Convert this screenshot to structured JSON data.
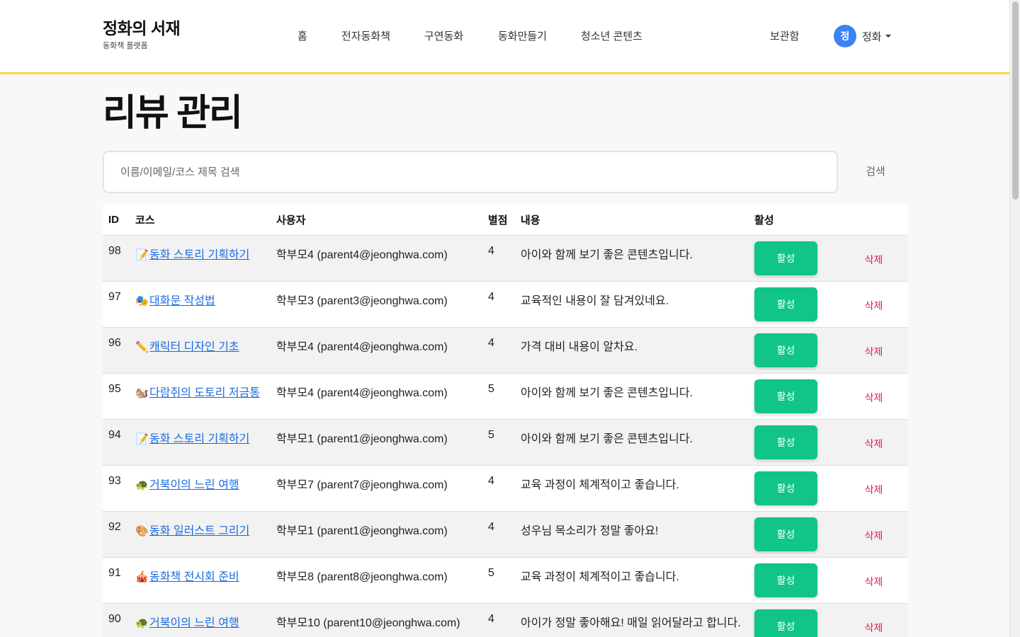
{
  "header": {
    "brand_title": "정화의 서재",
    "brand_subtitle": "동화책 플랫폼",
    "nav": [
      "홈",
      "전자동화책",
      "구연동화",
      "동화만들기",
      "청소년 콘텐츠"
    ],
    "storage": "보관함",
    "user": {
      "avatar_initial": "정",
      "name": "정화"
    },
    "accent_color": "#f8d548"
  },
  "page": {
    "title": "리뷰 관리"
  },
  "search": {
    "placeholder": "이름/이메일/코스 제목 검색",
    "value": "",
    "button": "검색"
  },
  "table": {
    "headers": {
      "id": "ID",
      "course": "코스",
      "user": "사용자",
      "rating": "별점",
      "content": "내용",
      "status": "활성"
    },
    "rows": [
      {
        "id": "98",
        "emoji": "📝",
        "course": "동화 스토리 기획하기",
        "user": "학부모4 (parent4@jeonghwa.com)",
        "rating": "4",
        "content": "아이와 함께 보기 좋은 콘텐츠입니다.",
        "status": "활성",
        "delete": "삭제"
      },
      {
        "id": "97",
        "emoji": "🎭",
        "course": "대화문 작성법",
        "user": "학부모3 (parent3@jeonghwa.com)",
        "rating": "4",
        "content": "교육적인 내용이 잘 담겨있네요.",
        "status": "활성",
        "delete": "삭제"
      },
      {
        "id": "96",
        "emoji": "✏️",
        "course": "캐릭터 디자인 기초",
        "user": "학부모4 (parent4@jeonghwa.com)",
        "rating": "4",
        "content": "가격 대비 내용이 알차요.",
        "status": "활성",
        "delete": "삭제"
      },
      {
        "id": "95",
        "emoji": "🐿️",
        "course": "다람쥐의 도토리 저금통",
        "user": "학부모4 (parent4@jeonghwa.com)",
        "rating": "5",
        "content": "아이와 함께 보기 좋은 콘텐츠입니다.",
        "status": "활성",
        "delete": "삭제"
      },
      {
        "id": "94",
        "emoji": "📝",
        "course": "동화 스토리 기획하기",
        "user": "학부모1 (parent1@jeonghwa.com)",
        "rating": "5",
        "content": "아이와 함께 보기 좋은 콘텐츠입니다.",
        "status": "활성",
        "delete": "삭제"
      },
      {
        "id": "93",
        "emoji": "🐢",
        "course": "거북이의 느린 여행",
        "user": "학부모7 (parent7@jeonghwa.com)",
        "rating": "4",
        "content": "교육 과정이 체계적이고 좋습니다.",
        "status": "활성",
        "delete": "삭제"
      },
      {
        "id": "92",
        "emoji": "🎨",
        "course": "동화 일러스트 그리기",
        "user": "학부모1 (parent1@jeonghwa.com)",
        "rating": "4",
        "content": "성우님 목소리가 정말 좋아요!",
        "status": "활성",
        "delete": "삭제"
      },
      {
        "id": "91",
        "emoji": "🎪",
        "course": "동화책 전시회 준비",
        "user": "학부모8 (parent8@jeonghwa.com)",
        "rating": "5",
        "content": "교육 과정이 체계적이고 좋습니다.",
        "status": "활성",
        "delete": "삭제"
      },
      {
        "id": "90",
        "emoji": "🐢",
        "course": "거북이의 느린 여행",
        "user": "학부모10 (parent10@jeonghwa.com)",
        "rating": "4",
        "content": "아이가 정말 좋아해요! 매일 읽어달라고 합니다.",
        "status": "활성",
        "delete": "삭제"
      }
    ]
  }
}
